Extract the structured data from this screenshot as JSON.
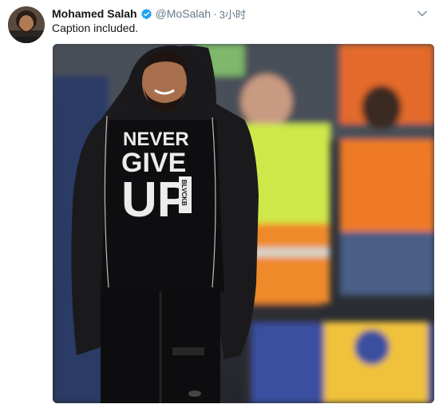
{
  "tweet": {
    "display_name": "Mohamed Salah",
    "handle": "@MoSalah",
    "separator": "·",
    "time": "3小时",
    "text": "Caption included."
  },
  "media": {
    "shirt_line1": "NEVER",
    "shirt_line2": "GIVE",
    "shirt_line3": "UP",
    "shirt_tag": "BLVCKB"
  },
  "icons": {
    "verified": "verified-badge-icon",
    "menu": "chevron-down-icon"
  },
  "colors": {
    "verified_blue": "#1da1f2",
    "name": "#14171a",
    "secondary": "#657786"
  }
}
